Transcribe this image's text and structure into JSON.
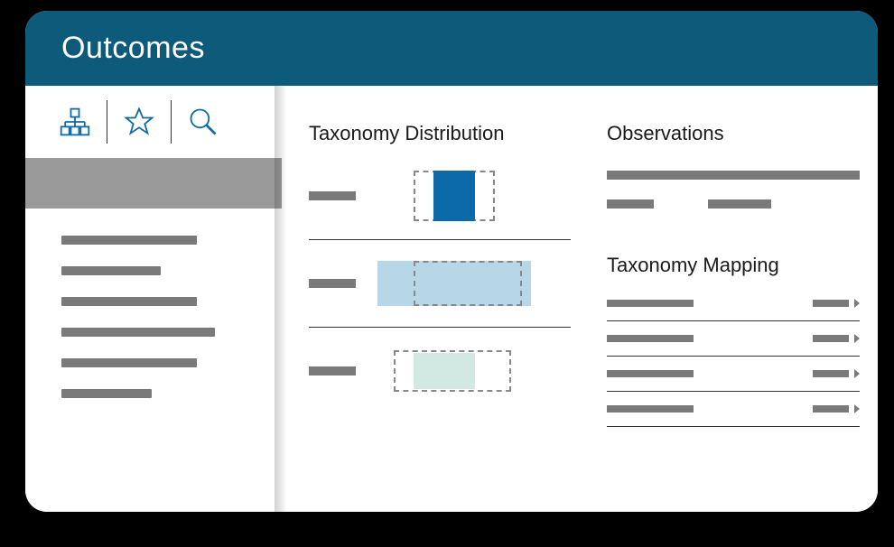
{
  "header": {
    "title": "Outcomes"
  },
  "sidebar": {
    "tools": [
      {
        "name": "hierarchy-icon"
      },
      {
        "name": "star-icon"
      },
      {
        "name": "search-icon"
      }
    ]
  },
  "sections": {
    "taxonomy_distribution": {
      "title": "Taxonomy Distribution",
      "rows": [
        {
          "fill_color": "#0d6aa8",
          "bg_color": "transparent"
        },
        {
          "fill_color": "#b7d6e8",
          "bg_color": "#b7d6e8"
        },
        {
          "fill_color": "#d2e8e3",
          "bg_color": "transparent"
        }
      ]
    },
    "observations": {
      "title": "Observations"
    },
    "taxonomy_mapping": {
      "title": "Taxonomy Mapping"
    }
  }
}
